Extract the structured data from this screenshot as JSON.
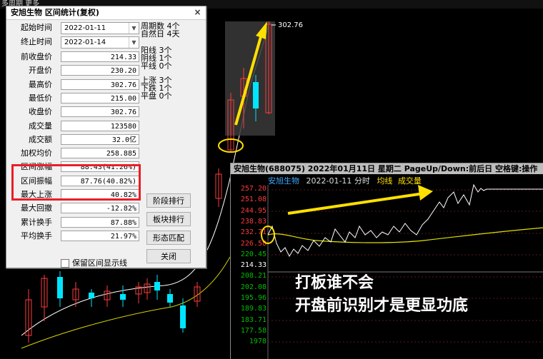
{
  "topbar": {
    "text": "多周期  更多"
  },
  "dialog": {
    "title": "安旭生物 区间统计(复权)",
    "close_label": "×",
    "start_label": "起始时间",
    "start_value": "2022-01-11",
    "end_label": "终止时间",
    "end_value": "2022-01-14",
    "fields": [
      {
        "label": "前收盘价",
        "value": "214.33"
      },
      {
        "label": "开盘价",
        "value": "230.20"
      },
      {
        "label": "最高价",
        "value": "302.76"
      },
      {
        "label": "最低价",
        "value": "215.00"
      },
      {
        "label": "收盘价",
        "value": "302.76"
      },
      {
        "label": "成交量",
        "value": "123580"
      },
      {
        "label": "成交额",
        "value": "32.0亿"
      },
      {
        "label": "加权均价",
        "value": "258.885"
      },
      {
        "label": "区间涨幅",
        "value": "88.43(41.26%)"
      },
      {
        "label": "区间振幅",
        "value": "87.76(40.82%)"
      },
      {
        "label": "最大上涨",
        "value": "40.82%"
      },
      {
        "label": "最大回撤",
        "value": "-12.82%"
      },
      {
        "label": "累计换手",
        "value": "87.88%"
      },
      {
        "label": "平均换手",
        "value": "21.97%"
      }
    ],
    "side_stats": {
      "period_label": "周期数",
      "period_value": "4个",
      "natural_label": "自然日",
      "natural_value": "4天",
      "yang_label": "阳线",
      "yang_value": "3个",
      "yin_label": "阴线",
      "yin_value": "1个",
      "flat_line_label": "平线",
      "flat_line_value": "0个",
      "up_label": "上涨",
      "up_value": "3个",
      "down_label": "下跌",
      "down_value": "1个",
      "flat_label": "平盘",
      "flat_value": "0个"
    },
    "buttons": {
      "stage_rank": "阶段排行",
      "sector_rank": "板块排行",
      "pattern_match": "形态匹配",
      "close": "关闭"
    },
    "checkbox_label": "保留区间显示线"
  },
  "kline": {
    "high_label": "302.76"
  },
  "intraday": {
    "title": "安旭生物(688075) 2022年01月11日 星期二 PageUp/Down:前后日 空格键:操作",
    "legend_name": "安旭生物",
    "legend_date": "2022-01-11 分时",
    "legend_avg": "均线",
    "legend_vol": "成交量",
    "y_ticks": [
      "257.20",
      "251.08",
      "244.95",
      "238.83",
      "232.71",
      "226.58",
      "220.45",
      "214.33",
      "208.21",
      "202.08",
      "195.96",
      "189.83",
      "183.71",
      "177.58",
      "1978"
    ],
    "colors": {
      "up": "#ff3b3b",
      "down": "#00c000",
      "neutral": "#ffffff",
      "price_line": "#ffffff",
      "avg_line": "#e0e000"
    }
  },
  "annotations": {
    "line1": "打板谁不会",
    "line2": "开盘前识别才是更显功底"
  }
}
